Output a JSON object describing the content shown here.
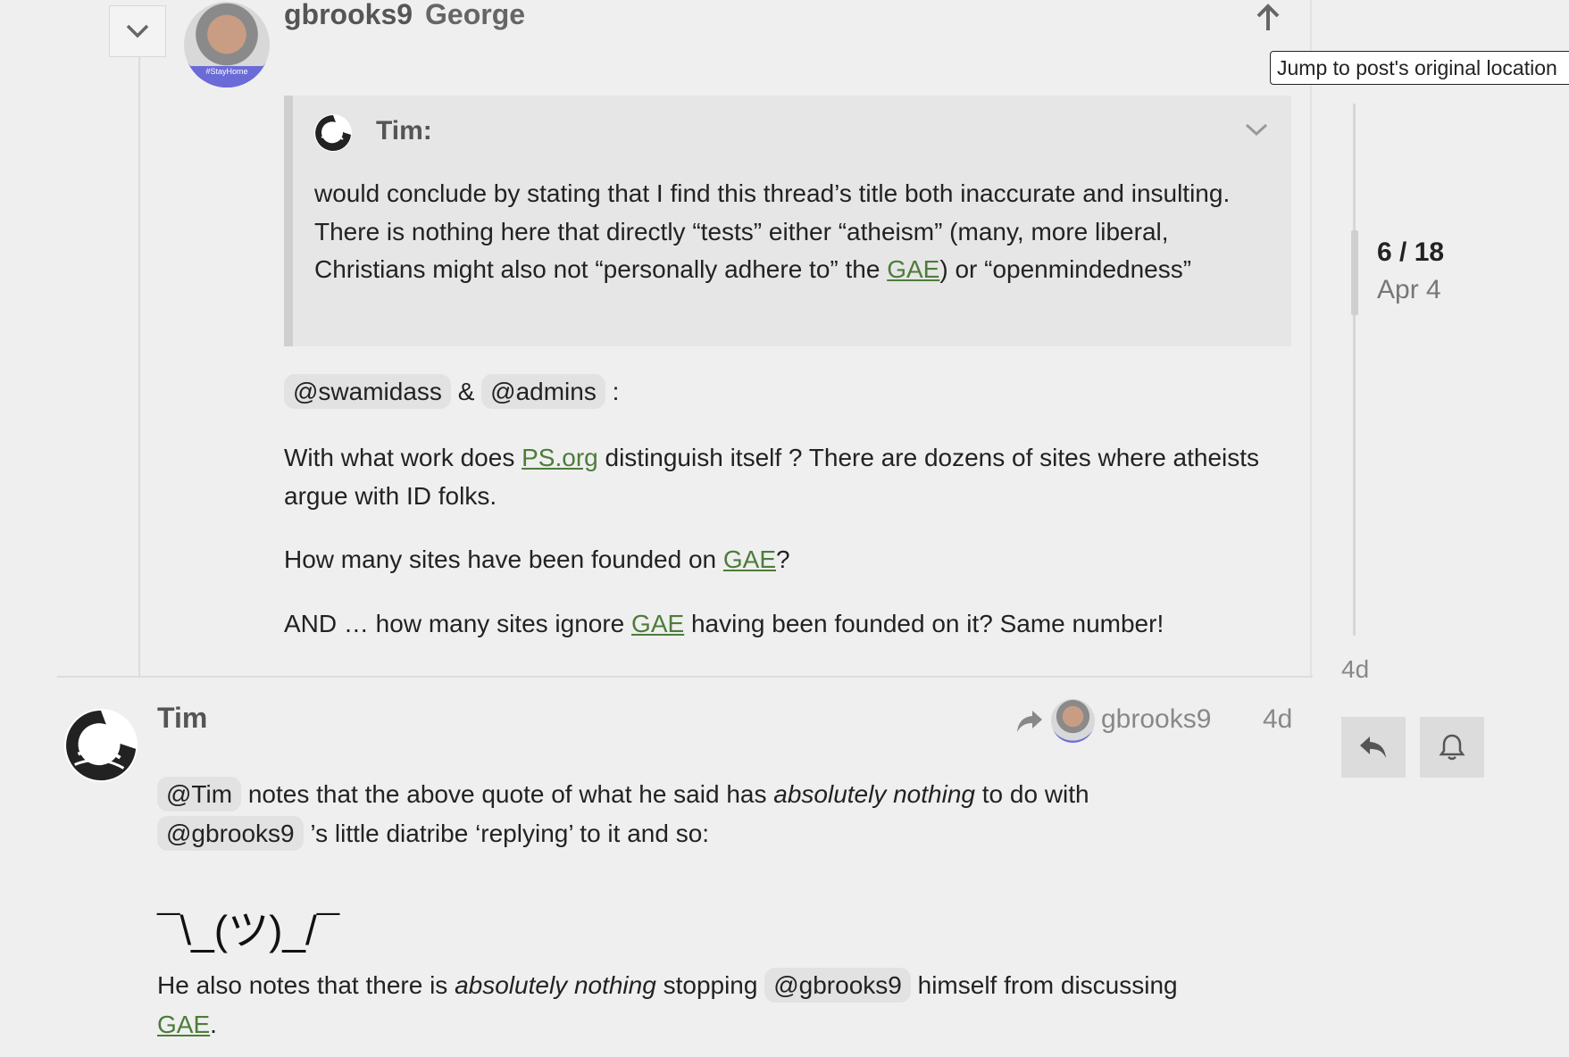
{
  "top_post": {
    "username": "gbrooks9",
    "fullname": "George",
    "avatar_text": "#StayHome",
    "tooltip": "Jump to post's original location",
    "quote": {
      "author": "Tim:",
      "text_1": "would conclude by stating that I find this thread’s title both inaccurate and insulting. There is nothing here that directly “tests” either “atheism” (many, more liberal, Christians might also not “personally adhere to” the ",
      "link": "GAE",
      "text_2": ") or “openmindedness”"
    },
    "mentions_line": {
      "m1": "@swamidass",
      "amp": "&",
      "m2": "@admins",
      "colon": ":"
    },
    "para1": {
      "a": "With what work does ",
      "link": "PS.org",
      "b": " distinguish itself ? There are dozens of sites where atheists argue with ID folks."
    },
    "para2": {
      "a": "How many sites have been founded on ",
      "link": "GAE",
      "b": "?"
    },
    "para3": {
      "a": "AND … how many sites ignore ",
      "link": "GAE",
      "b": " having been founded on it? Same number!"
    }
  },
  "timeline": {
    "position": "6 / 18",
    "date": "Apr 4",
    "bottom_age": "4d"
  },
  "bottom_post": {
    "username": "Tim",
    "reply_to": "gbrooks9",
    "age": "4d",
    "line1": {
      "mention": "@Tim",
      "a": " notes that the above quote of what he said has ",
      "em": "absolutely nothing",
      "b": " to do with"
    },
    "line2": {
      "mention": "@gbrooks9",
      "a": " ’s little diatribe ‘replying’ to it and so:"
    },
    "shrug": "¯\\_(ツ)_/¯",
    "line3": {
      "a": "He also notes that there is ",
      "em": "absolutely nothing",
      "b": " stopping ",
      "mention": "@gbrooks9",
      "c": " himself from discussing"
    },
    "line4": {
      "link": "GAE",
      "a": "."
    }
  },
  "icons": [
    "chevron-down-icon",
    "arrow-up-icon",
    "share-reply-icon",
    "reply-icon",
    "bell-icon"
  ]
}
